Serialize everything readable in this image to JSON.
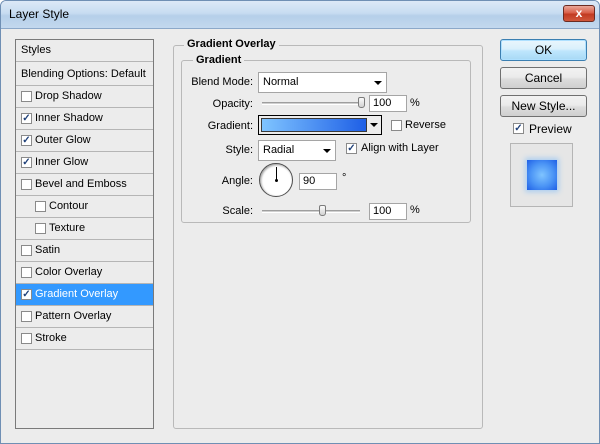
{
  "window": {
    "title": "Layer Style",
    "close_glyph": "x"
  },
  "styles_list": {
    "header": "Styles",
    "blending": "Blending Options: Default",
    "items": [
      {
        "label": "Drop Shadow",
        "checked": false,
        "indent": false,
        "selected": false
      },
      {
        "label": "Inner Shadow",
        "checked": true,
        "indent": false,
        "selected": false
      },
      {
        "label": "Outer Glow",
        "checked": true,
        "indent": false,
        "selected": false
      },
      {
        "label": "Inner Glow",
        "checked": true,
        "indent": false,
        "selected": false
      },
      {
        "label": "Bevel and Emboss",
        "checked": false,
        "indent": false,
        "selected": false
      },
      {
        "label": "Contour",
        "checked": false,
        "indent": true,
        "selected": false
      },
      {
        "label": "Texture",
        "checked": false,
        "indent": true,
        "selected": false
      },
      {
        "label": "Satin",
        "checked": false,
        "indent": false,
        "selected": false
      },
      {
        "label": "Color Overlay",
        "checked": false,
        "indent": false,
        "selected": false
      },
      {
        "label": "Gradient Overlay",
        "checked": true,
        "indent": false,
        "selected": true
      },
      {
        "label": "Pattern Overlay",
        "checked": false,
        "indent": false,
        "selected": false
      },
      {
        "label": "Stroke",
        "checked": false,
        "indent": false,
        "selected": false
      }
    ]
  },
  "panel": {
    "group_title": "Gradient Overlay",
    "subgroup_title": "Gradient",
    "blend_mode": {
      "label": "Blend Mode:",
      "value": "Normal"
    },
    "opacity": {
      "label": "Opacity:",
      "value": "100",
      "unit": "%",
      "percent": 100
    },
    "gradient": {
      "label": "Gradient:",
      "color_start": "#7fc4ff",
      "color_end": "#1e5fe6"
    },
    "reverse": {
      "label": "Reverse",
      "checked": false
    },
    "style": {
      "label": "Style:",
      "value": "Radial"
    },
    "align_layer": {
      "label": "Align with Layer",
      "checked": true
    },
    "angle": {
      "label": "Angle:",
      "value": "90",
      "unit": "°"
    },
    "scale": {
      "label": "Scale:",
      "value": "100",
      "unit": "%",
      "percent": 100
    }
  },
  "buttons": {
    "ok": "OK",
    "cancel": "Cancel",
    "new_style": "New Style...",
    "preview_label": "Preview",
    "preview_checked": true
  },
  "colors": {
    "selection": "#3399ff",
    "preview_center": "#7fc4ff",
    "preview_edge": "#1e5fe6"
  },
  "icons": {
    "close": "close-icon",
    "dropdown": "chevron-down-icon",
    "checkbox": "checkmark-icon",
    "angle": "angle-dial-icon"
  }
}
